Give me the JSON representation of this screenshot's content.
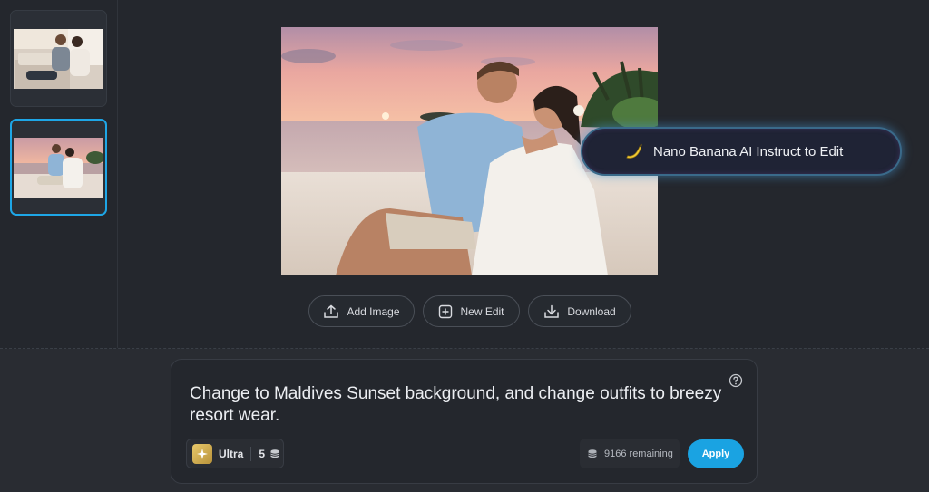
{
  "thumbnails": [
    {
      "name": "indoor-couple-photo",
      "selected": false
    },
    {
      "name": "beach-sunset-couple-photo",
      "selected": true
    }
  ],
  "toolbar": {
    "add_image_label": "Add Image",
    "new_edit_label": "New Edit",
    "download_label": "Download"
  },
  "banana_pill": {
    "icon": "banana-icon",
    "label": "Nano Banana AI Instruct to Edit"
  },
  "prompt": {
    "text": "Change to Maldives Sunset background, and change outfits to breezy resort wear.",
    "help_icon": "question-circle-icon"
  },
  "model": {
    "name": "Ultra",
    "cost": "5",
    "badge_icon": "sparkle-icon",
    "credit_icon": "coin-stack-icon"
  },
  "credits": {
    "remaining_text": "9166 remaining"
  },
  "apply_label": "Apply",
  "colors": {
    "accent": "#1aa3e2",
    "background": "#24272d",
    "selected_border": "#1ea6e6"
  }
}
